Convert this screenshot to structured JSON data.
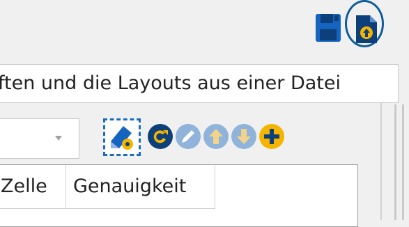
{
  "toolbar_top": {
    "save_icon": "save-disk-icon",
    "load_icon": "load-file-icon",
    "accent": "#0f5b9c"
  },
  "tooltip": {
    "text": "ften und die Layouts aus einer Datei"
  },
  "toolbar": {
    "tools": [
      "edit-settings-icon",
      "refresh-icon",
      "edit-pencil-icon",
      "move-up-icon",
      "move-down-icon",
      "add-icon"
    ]
  },
  "grid": {
    "columns": [
      "Zelle",
      "Genauigkeit"
    ]
  }
}
